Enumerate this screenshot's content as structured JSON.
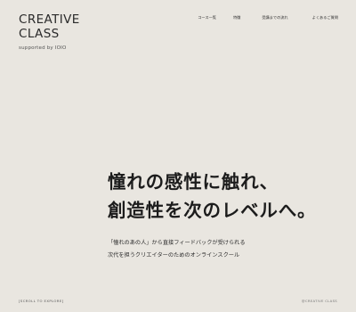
{
  "header": {
    "logo_line1": "CREATIVE",
    "logo_line2": "CLASS",
    "logo_sub": "supported by IOIO",
    "nav": [
      {
        "label": "コース一覧"
      },
      {
        "label": "特徴"
      },
      {
        "label": "受講までの流れ"
      },
      {
        "label": "よくあるご質問"
      }
    ]
  },
  "hero": {
    "line1": "憧れの感性に触れ、",
    "line2": "創造性を次のレベルへ。"
  },
  "description": {
    "line1": "「憧れのあの人」から直接フィードバックが受けられる",
    "line2": "次代を担うクリエイターのためのオンラインスクール"
  },
  "footer": {
    "scroll_hint": "[SCROLL TO EXPLORE]",
    "copyright": "@CREATIVE CLASS"
  }
}
